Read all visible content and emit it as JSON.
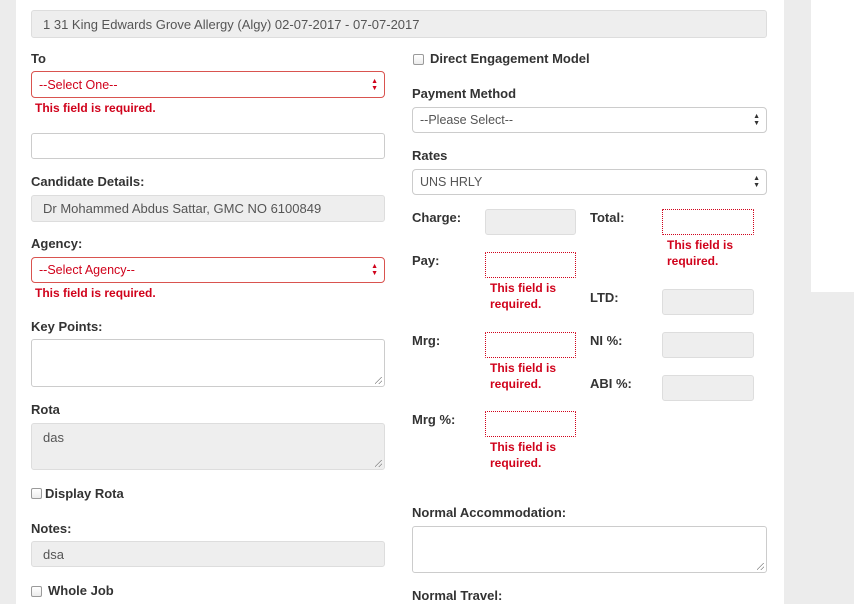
{
  "header": {
    "summary": "1 31 King Edwards Grove  Allergy (Algy) 02-07-2017 - 07-07-2017"
  },
  "left": {
    "to_label": "To",
    "to_select": "--Select One--",
    "to_error": "This field is required.",
    "extra_value": "",
    "candidate_label": "Candidate Details:",
    "candidate_value": "Dr  Mohammed Abdus Sattar, GMC NO 6100849",
    "agency_label": "Agency:",
    "agency_select": "--Select Agency--",
    "agency_error": "This field is required.",
    "keypoints_label": "Key Points:",
    "keypoints_value": "",
    "rota_label": "Rota",
    "rota_value": "das",
    "display_rota_label": "Display Rota",
    "notes_label": "Notes:",
    "notes_value": "dsa",
    "whole_job_label": "Whole Job"
  },
  "right": {
    "dem_label": "Direct Engagement Model",
    "payment_label": "Payment Method",
    "payment_select": "--Please Select--",
    "rates_label": "Rates",
    "rates_select": "UNS HRLY",
    "charge_label": "Charge:",
    "total_label": "Total:",
    "total_error": "This field is required.",
    "pay_label": "Pay:",
    "pay_error": "This field is required.",
    "ltd_label": "LTD:",
    "mrg_label": "Mrg:",
    "mrg_error": "This field is required.",
    "ni_label": "NI %:",
    "abi_label": "ABI %:",
    "mrgpct_label": "Mrg %:",
    "mrgpct_error": "This field is required.",
    "normal_accom_label": "Normal Accommodation:",
    "normal_travel_label": "Normal Travel:"
  },
  "colors": {
    "error": "#d0021b",
    "readonly_bg": "#eeeeee",
    "page_bg": "#ececec"
  }
}
